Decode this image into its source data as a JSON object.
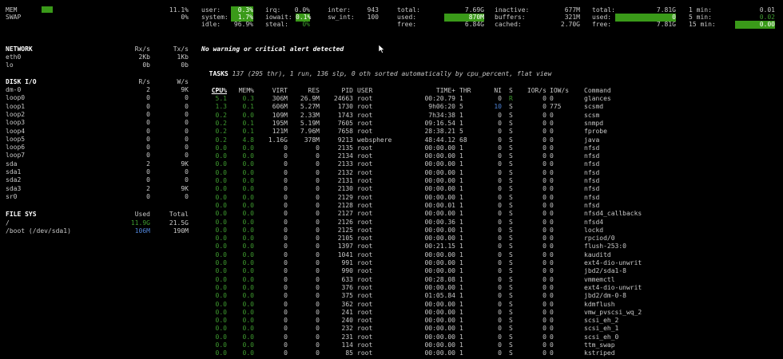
{
  "summary": {
    "mem_label": "MEM",
    "mem_value": "11.1%",
    "swap_label": "SWAP",
    "swap_value": "0%",
    "cpu": {
      "user_label": "user:",
      "user_value": "0.3%",
      "system_label": "system:",
      "system_value": "1.7%",
      "idle_label": "idle:",
      "idle_value": "96.9%",
      "irq_label": "irq:",
      "irq_value": "0.0%",
      "iowait_label": "iowait:",
      "iowait_value": "0.1%",
      "steal_label": "steal:",
      "steal_value": "0%",
      "inter_label": "inter:",
      "inter_value": "943",
      "swint_label": "sw_int:",
      "swint_value": "100"
    },
    "mem": {
      "total_label": "total:",
      "total_value": "7.69G",
      "used_label": "used:",
      "used_value": "870M",
      "free_label": "free:",
      "free_value": "6.84G",
      "inactive_label": "inactive:",
      "inactive_value": "677M",
      "buffers_label": "buffers:",
      "buffers_value": "321M",
      "cached_label": "cached:",
      "cached_value": "2.70G"
    },
    "swap": {
      "total_label": "total:",
      "total_value": "7.81G",
      "used_label": "used:",
      "used_value": "0",
      "free_label": "free:",
      "free_value": "7.81G"
    },
    "load": {
      "min1_label": "1 min:",
      "min1_value": "0.01",
      "min5_label": "5 min:",
      "min5_value": "0.02",
      "min15_label": "15 min:",
      "min15_value": "0.00"
    }
  },
  "network": {
    "title": "NETWORK",
    "rx_header": "Rx/s",
    "tx_header": "Tx/s",
    "rows": [
      {
        "name": "eth0",
        "rx": "2Kb",
        "tx": "1Kb"
      },
      {
        "name": "lo",
        "rx": "0b",
        "tx": "0b"
      }
    ]
  },
  "disk_io": {
    "title": "DISK I/O",
    "r_header": "R/s",
    "w_header": "W/s",
    "rows": [
      {
        "name": "dm-0",
        "r": "2",
        "w": "9K"
      },
      {
        "name": "loop0",
        "r": "0",
        "w": "0"
      },
      {
        "name": "loop1",
        "r": "0",
        "w": "0"
      },
      {
        "name": "loop2",
        "r": "0",
        "w": "0"
      },
      {
        "name": "loop3",
        "r": "0",
        "w": "0"
      },
      {
        "name": "loop4",
        "r": "0",
        "w": "0"
      },
      {
        "name": "loop5",
        "r": "0",
        "w": "0"
      },
      {
        "name": "loop6",
        "r": "0",
        "w": "0"
      },
      {
        "name": "loop7",
        "r": "0",
        "w": "0"
      },
      {
        "name": "sda",
        "r": "2",
        "w": "9K"
      },
      {
        "name": "sda1",
        "r": "0",
        "w": "0"
      },
      {
        "name": "sda2",
        "r": "0",
        "w": "0"
      },
      {
        "name": "sda3",
        "r": "2",
        "w": "9K"
      },
      {
        "name": "sr0",
        "r": "0",
        "w": "0"
      }
    ]
  },
  "file_sys": {
    "title": "FILE SYS",
    "used_header": "Used",
    "total_header": "Total",
    "rows": [
      {
        "name": "/",
        "used": "11.9G",
        "total": "21.5G"
      },
      {
        "name": "/boot (/dev/sda1)",
        "used": "106M",
        "total": "190M"
      }
    ]
  },
  "alert": "No warning or critical alert detected",
  "tasks": {
    "label": "TASKS",
    "text": " 137 (295 thr), 1 run, 136 slp, 0 oth sorted automatically by cpu_percent, flat view"
  },
  "process_headers": {
    "cpu": "CPU%",
    "mem": "MEM%",
    "virt": "VIRT",
    "res": "RES",
    "pid": "PID",
    "user": "USER",
    "time": "TIME+",
    "thr": "THR",
    "ni": "NI",
    "s": "S",
    "ior": "IOR/s",
    "iow": "IOW/s",
    "command": "Command"
  },
  "processes": [
    {
      "cpu": "5.1",
      "mem": "0.3",
      "virt": "306M",
      "res": "26.9M",
      "pid": "24663",
      "user": "root",
      "time": "00:20.79",
      "thr": "1",
      "ni": "0",
      "s": "R",
      "ior": "0",
      "iow": "0",
      "command": "glances"
    },
    {
      "cpu": "1.3",
      "mem": "0.1",
      "virt": "606M",
      "res": "5.27M",
      "pid": "1730",
      "user": "root",
      "time": "9h06:20",
      "thr": "5",
      "ni": "10",
      "s": "S",
      "ior": "0",
      "iow": "775",
      "command": "scsmd"
    },
    {
      "cpu": "0.2",
      "mem": "0.0",
      "virt": "109M",
      "res": "2.33M",
      "pid": "1743",
      "user": "root",
      "time": "7h34:38",
      "thr": "1",
      "ni": "0",
      "s": "S",
      "ior": "0",
      "iow": "0",
      "command": "scsm"
    },
    {
      "cpu": "0.2",
      "mem": "0.1",
      "virt": "195M",
      "res": "5.19M",
      "pid": "7605",
      "user": "root",
      "time": "09:16.54",
      "thr": "1",
      "ni": "0",
      "s": "S",
      "ior": "0",
      "iow": "0",
      "command": "snmpd"
    },
    {
      "cpu": "0.2",
      "mem": "0.1",
      "virt": "121M",
      "res": "7.96M",
      "pid": "7658",
      "user": "root",
      "time": "28:38.21",
      "thr": "5",
      "ni": "0",
      "s": "S",
      "ior": "0",
      "iow": "0",
      "command": "fprobe"
    },
    {
      "cpu": "0.2",
      "mem": "4.8",
      "virt": "1.16G",
      "res": "378M",
      "pid": "9213",
      "user": "websphere",
      "time": "48:44.12",
      "thr": "68",
      "ni": "0",
      "s": "S",
      "ior": "0",
      "iow": "0",
      "command": "java"
    },
    {
      "cpu": "0.0",
      "mem": "0.0",
      "virt": "0",
      "res": "0",
      "pid": "2135",
      "user": "root",
      "time": "00:00.00",
      "thr": "1",
      "ni": "0",
      "s": "S",
      "ior": "0",
      "iow": "0",
      "command": "nfsd"
    },
    {
      "cpu": "0.0",
      "mem": "0.0",
      "virt": "0",
      "res": "0",
      "pid": "2134",
      "user": "root",
      "time": "00:00.00",
      "thr": "1",
      "ni": "0",
      "s": "S",
      "ior": "0",
      "iow": "0",
      "command": "nfsd"
    },
    {
      "cpu": "0.0",
      "mem": "0.0",
      "virt": "0",
      "res": "0",
      "pid": "2133",
      "user": "root",
      "time": "00:00.00",
      "thr": "1",
      "ni": "0",
      "s": "S",
      "ior": "0",
      "iow": "0",
      "command": "nfsd"
    },
    {
      "cpu": "0.0",
      "mem": "0.0",
      "virt": "0",
      "res": "0",
      "pid": "2132",
      "user": "root",
      "time": "00:00.00",
      "thr": "1",
      "ni": "0",
      "s": "S",
      "ior": "0",
      "iow": "0",
      "command": "nfsd"
    },
    {
      "cpu": "0.0",
      "mem": "0.0",
      "virt": "0",
      "res": "0",
      "pid": "2131",
      "user": "root",
      "time": "00:00.00",
      "thr": "1",
      "ni": "0",
      "s": "S",
      "ior": "0",
      "iow": "0",
      "command": "nfsd"
    },
    {
      "cpu": "0.0",
      "mem": "0.0",
      "virt": "0",
      "res": "0",
      "pid": "2130",
      "user": "root",
      "time": "00:00.00",
      "thr": "1",
      "ni": "0",
      "s": "S",
      "ior": "0",
      "iow": "0",
      "command": "nfsd"
    },
    {
      "cpu": "0.0",
      "mem": "0.0",
      "virt": "0",
      "res": "0",
      "pid": "2129",
      "user": "root",
      "time": "00:00.00",
      "thr": "1",
      "ni": "0",
      "s": "S",
      "ior": "0",
      "iow": "0",
      "command": "nfsd"
    },
    {
      "cpu": "0.0",
      "mem": "0.0",
      "virt": "0",
      "res": "0",
      "pid": "2128",
      "user": "root",
      "time": "00:00.01",
      "thr": "1",
      "ni": "0",
      "s": "S",
      "ior": "0",
      "iow": "0",
      "command": "nfsd"
    },
    {
      "cpu": "0.0",
      "mem": "0.0",
      "virt": "0",
      "res": "0",
      "pid": "2127",
      "user": "root",
      "time": "00:00.00",
      "thr": "1",
      "ni": "0",
      "s": "S",
      "ior": "0",
      "iow": "0",
      "command": "nfsd4_callbacks"
    },
    {
      "cpu": "0.0",
      "mem": "0.0",
      "virt": "0",
      "res": "0",
      "pid": "2126",
      "user": "root",
      "time": "00:00.36",
      "thr": "1",
      "ni": "0",
      "s": "S",
      "ior": "0",
      "iow": "0",
      "command": "nfsd4"
    },
    {
      "cpu": "0.0",
      "mem": "0.0",
      "virt": "0",
      "res": "0",
      "pid": "2125",
      "user": "root",
      "time": "00:00.00",
      "thr": "1",
      "ni": "0",
      "s": "S",
      "ior": "0",
      "iow": "0",
      "command": "lockd"
    },
    {
      "cpu": "0.0",
      "mem": "0.0",
      "virt": "0",
      "res": "0",
      "pid": "2105",
      "user": "root",
      "time": "00:00.00",
      "thr": "1",
      "ni": "0",
      "s": "S",
      "ior": "0",
      "iow": "0",
      "command": "rpciod/0"
    },
    {
      "cpu": "0.0",
      "mem": "0.0",
      "virt": "0",
      "res": "0",
      "pid": "1397",
      "user": "root",
      "time": "00:21.15",
      "thr": "1",
      "ni": "0",
      "s": "S",
      "ior": "0",
      "iow": "0",
      "command": "flush-253:0"
    },
    {
      "cpu": "0.0",
      "mem": "0.0",
      "virt": "0",
      "res": "0",
      "pid": "1041",
      "user": "root",
      "time": "00:00.00",
      "thr": "1",
      "ni": "0",
      "s": "S",
      "ior": "0",
      "iow": "0",
      "command": "kauditd"
    },
    {
      "cpu": "0.0",
      "mem": "0.0",
      "virt": "0",
      "res": "0",
      "pid": "991",
      "user": "root",
      "time": "00:00.00",
      "thr": "1",
      "ni": "0",
      "s": "S",
      "ior": "0",
      "iow": "0",
      "command": "ext4-dio-unwrit"
    },
    {
      "cpu": "0.0",
      "mem": "0.0",
      "virt": "0",
      "res": "0",
      "pid": "990",
      "user": "root",
      "time": "00:00.00",
      "thr": "1",
      "ni": "0",
      "s": "S",
      "ior": "0",
      "iow": "0",
      "command": "jbd2/sda1-8"
    },
    {
      "cpu": "0.0",
      "mem": "0.0",
      "virt": "0",
      "res": "0",
      "pid": "633",
      "user": "root",
      "time": "00:28.08",
      "thr": "1",
      "ni": "0",
      "s": "S",
      "ior": "0",
      "iow": "0",
      "command": "vmmemctl"
    },
    {
      "cpu": "0.0",
      "mem": "0.0",
      "virt": "0",
      "res": "0",
      "pid": "376",
      "user": "root",
      "time": "00:00.00",
      "thr": "1",
      "ni": "0",
      "s": "S",
      "ior": "0",
      "iow": "0",
      "command": "ext4-dio-unwrit"
    },
    {
      "cpu": "0.0",
      "mem": "0.0",
      "virt": "0",
      "res": "0",
      "pid": "375",
      "user": "root",
      "time": "01:05.84",
      "thr": "1",
      "ni": "0",
      "s": "S",
      "ior": "0",
      "iow": "0",
      "command": "jbd2/dm-0-8"
    },
    {
      "cpu": "0.0",
      "mem": "0.0",
      "virt": "0",
      "res": "0",
      "pid": "362",
      "user": "root",
      "time": "00:00.00",
      "thr": "1",
      "ni": "0",
      "s": "S",
      "ior": "0",
      "iow": "0",
      "command": "kdmflush"
    },
    {
      "cpu": "0.0",
      "mem": "0.0",
      "virt": "0",
      "res": "0",
      "pid": "241",
      "user": "root",
      "time": "00:00.00",
      "thr": "1",
      "ni": "0",
      "s": "S",
      "ior": "0",
      "iow": "0",
      "command": "vmw_pvscsi_wq_2"
    },
    {
      "cpu": "0.0",
      "mem": "0.0",
      "virt": "0",
      "res": "0",
      "pid": "240",
      "user": "root",
      "time": "00:00.00",
      "thr": "1",
      "ni": "0",
      "s": "S",
      "ior": "0",
      "iow": "0",
      "command": "scsi_eh_2"
    },
    {
      "cpu": "0.0",
      "mem": "0.0",
      "virt": "0",
      "res": "0",
      "pid": "232",
      "user": "root",
      "time": "00:00.00",
      "thr": "1",
      "ni": "0",
      "s": "S",
      "ior": "0",
      "iow": "0",
      "command": "scsi_eh_1"
    },
    {
      "cpu": "0.0",
      "mem": "0.0",
      "virt": "0",
      "res": "0",
      "pid": "231",
      "user": "root",
      "time": "00:00.00",
      "thr": "1",
      "ni": "0",
      "s": "S",
      "ior": "0",
      "iow": "0",
      "command": "scsi_eh_0"
    },
    {
      "cpu": "0.0",
      "mem": "0.0",
      "virt": "0",
      "res": "0",
      "pid": "114",
      "user": "root",
      "time": "00:00.00",
      "thr": "1",
      "ni": "0",
      "s": "S",
      "ior": "0",
      "iow": "0",
      "command": "ttm_swap"
    },
    {
      "cpu": "0.0",
      "mem": "0.0",
      "virt": "0",
      "res": "0",
      "pid": "85",
      "user": "root",
      "time": "00:00.00",
      "thr": "1",
      "ni": "0",
      "s": "S",
      "ior": "0",
      "iow": "0",
      "command": "kstriped"
    }
  ],
  "colors": {
    "bar_green": "#3a9a19",
    "value_green": "#3e9a2f",
    "link_blue": "#4f83d6"
  }
}
